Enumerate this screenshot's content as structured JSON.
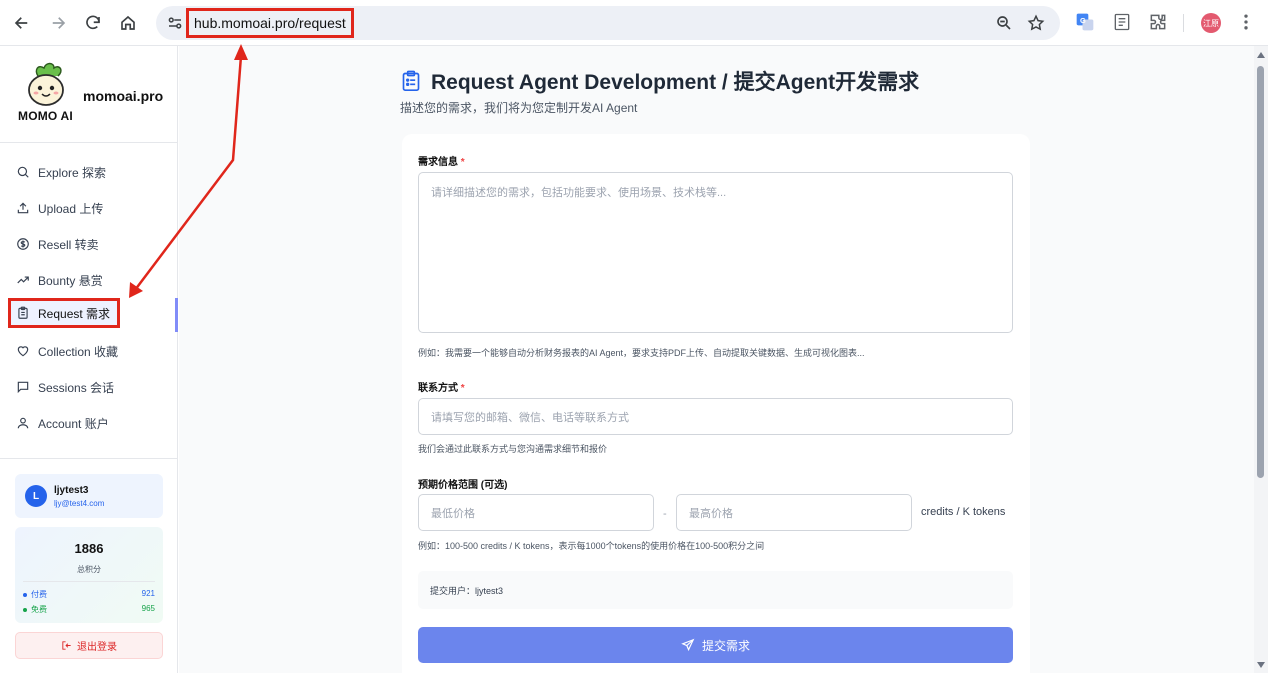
{
  "browser": {
    "url": "hub.momoai.pro/request",
    "profile_text": "江原"
  },
  "sidebar": {
    "logo_text": "MOMO AI",
    "site_name": "momoai.pro",
    "items": [
      {
        "label": "Explore 探索",
        "icon": "search-icon"
      },
      {
        "label": "Upload 上传",
        "icon": "upload-icon"
      },
      {
        "label": "Resell 转卖",
        "icon": "dollar-icon"
      },
      {
        "label": "Bounty 悬赏",
        "icon": "trending-icon"
      },
      {
        "label": "Request 需求",
        "icon": "clipboard-icon"
      },
      {
        "label": "Collection 收藏",
        "icon": "heart-icon"
      },
      {
        "label": "Sessions 会话",
        "icon": "chat-icon"
      },
      {
        "label": "Account 账户",
        "icon": "user-icon"
      }
    ],
    "user": {
      "initial": "L",
      "name": "ljytest3",
      "email": "ljy@test4.com"
    },
    "points": {
      "total": "1886",
      "total_label": "总积分",
      "paid_label": "付费",
      "paid_value": "921",
      "free_label": "免费",
      "free_value": "965"
    },
    "logout_label": "退出登录"
  },
  "main": {
    "title": "Request Agent Development / 提交Agent开发需求",
    "subtitle": "描述您的需求，我们将为您定制开发AI Agent",
    "form": {
      "req_label": "需求信息",
      "req_placeholder": "请详细描述您的需求，包括功能要求、使用场景、技术栈等...",
      "req_hint": "例如：我需要一个能够自动分析财务报表的AI Agent，要求支持PDF上传、自动提取关键数据、生成可视化图表...",
      "contact_label": "联系方式",
      "contact_placeholder": "请填写您的邮箱、微信、电话等联系方式",
      "contact_hint": "我们会通过此联系方式与您沟通需求细节和报价",
      "price_label": "预期价格范围 (可选)",
      "min_placeholder": "最低价格",
      "max_placeholder": "最高价格",
      "range_sep": "-",
      "unit": "credits / K tokens",
      "price_hint": "例如：100-500 credits / K tokens，表示每1000个tokens的使用价格在100-500积分之间",
      "submitter_text": "提交用户：ljytest3",
      "submit_label": "提交需求",
      "required_mark": "*"
    }
  },
  "colors": {
    "accent": "#6b85ed",
    "annotation": "#e0261b",
    "link_blue": "#2563eb"
  }
}
